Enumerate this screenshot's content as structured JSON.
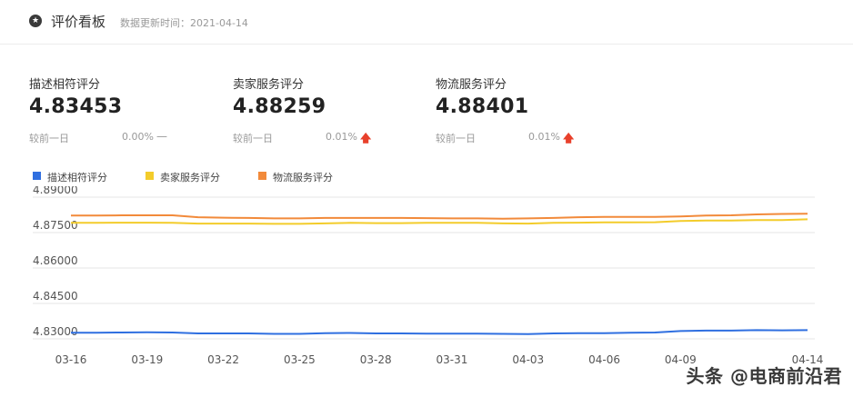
{
  "header": {
    "icon": "star-icon",
    "title": "评价看板",
    "updated": "数据更新时间：2021-04-14"
  },
  "metrics": [
    {
      "label": "描述相符评分",
      "value": "4.83453",
      "compare_label": "较前一日",
      "pct": "0.00%",
      "trend_symbol": "—",
      "trend": "flat"
    },
    {
      "label": "卖家服务评分",
      "value": "4.88259",
      "compare_label": "较前一日",
      "pct": "0.01%",
      "trend_symbol": "🡅",
      "trend": "up"
    },
    {
      "label": "物流服务评分",
      "value": "4.88401",
      "compare_label": "较前一日",
      "pct": "0.01%",
      "trend_symbol": "🡅",
      "trend": "up"
    }
  ],
  "colors": {
    "blue": "#2f6fe0",
    "yellow": "#f3cc2b",
    "orange": "#f28a3a",
    "grid": "#e6e6e6"
  },
  "watermark": "头条 @电商前沿君",
  "chart_data": {
    "type": "line",
    "x": [
      "03-16",
      "03-17",
      "03-18",
      "03-19",
      "03-20",
      "03-21",
      "03-22",
      "03-23",
      "03-24",
      "03-25",
      "03-26",
      "03-27",
      "03-28",
      "03-29",
      "03-30",
      "03-31",
      "04-01",
      "04-02",
      "04-03",
      "04-04",
      "04-05",
      "04-06",
      "04-07",
      "04-08",
      "04-09",
      "04-10",
      "04-11",
      "04-12",
      "04-13",
      "04-14"
    ],
    "tick_labels": [
      "03-16",
      "03-19",
      "03-22",
      "03-25",
      "03-28",
      "03-31",
      "04-03",
      "04-06",
      "04-09",
      "04-14"
    ],
    "y_ticks": [
      "4.89000",
      "4.87500",
      "4.86000",
      "4.84500",
      "4.83000"
    ],
    "ylim": [
      4.83,
      4.89
    ],
    "series": [
      {
        "name": "描述相符评分",
        "color": "#2f6fe0",
        "values": [
          4.8326,
          4.8326,
          4.8327,
          4.8328,
          4.8327,
          4.8323,
          4.8323,
          4.8323,
          4.8321,
          4.8321,
          4.8324,
          4.8325,
          4.8323,
          4.8323,
          4.8322,
          4.8322,
          4.8322,
          4.8321,
          4.832,
          4.8323,
          4.8324,
          4.8324,
          4.8326,
          4.8327,
          4.8333,
          4.8335,
          4.8335,
          4.8337,
          4.8336,
          4.8337
        ]
      },
      {
        "name": "卖家服务评分",
        "color": "#f3cc2b",
        "values": [
          4.8791,
          4.8791,
          4.8792,
          4.8792,
          4.8791,
          4.8788,
          4.8788,
          4.8788,
          4.8787,
          4.8787,
          4.8789,
          4.8791,
          4.879,
          4.879,
          4.8791,
          4.8791,
          4.8791,
          4.8789,
          4.8788,
          4.8791,
          4.8792,
          4.8793,
          4.8793,
          4.8794,
          4.8799,
          4.8801,
          4.8801,
          4.8803,
          4.8803,
          4.8806
        ]
      },
      {
        "name": "物流服务评分",
        "color": "#f28a3a",
        "values": [
          4.8822,
          4.8822,
          4.8823,
          4.8823,
          4.8823,
          4.8815,
          4.8813,
          4.8812,
          4.881,
          4.881,
          4.8812,
          4.8812,
          4.8812,
          4.8812,
          4.8811,
          4.881,
          4.881,
          4.8809,
          4.881,
          4.8812,
          4.8815,
          4.8816,
          4.8816,
          4.8816,
          4.8818,
          4.8822,
          4.8823,
          4.8827,
          4.8829,
          4.883
        ]
      }
    ]
  }
}
